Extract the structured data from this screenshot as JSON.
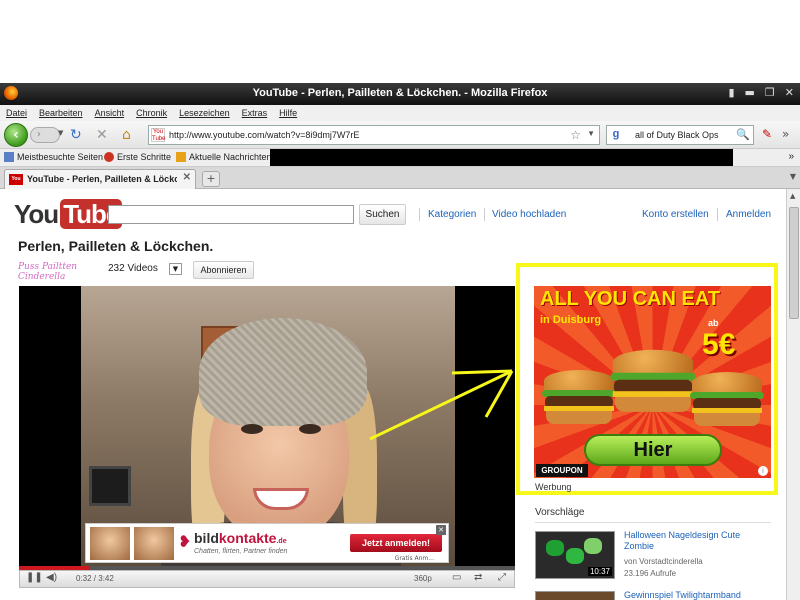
{
  "window": {
    "title": "YouTube - Perlen, Pailleten & Löckchen. - Mozilla Firefox"
  },
  "menu": [
    "Datei",
    "Bearbeiten",
    "Ansicht",
    "Chronik",
    "Lesezeichen",
    "Extras",
    "Hilfe"
  ],
  "navbar": {
    "url": "http://www.youtube.com/watch?v=8i9dmj7W7rE",
    "search_value": "all of Duty Black Ops"
  },
  "bookmarks": [
    "Meistbesuchte Seiten",
    "Erste Schritte",
    "Aktuelle Nachrichten"
  ],
  "tabs": [
    {
      "label": "YouTube - Perlen, Pailleten & Löckch..."
    }
  ],
  "youtube": {
    "logo_you": "You",
    "logo_tube": "Tube",
    "search_button": "Suchen",
    "links": [
      "Kategorien",
      "Video hochladen"
    ],
    "account_links": [
      "Konto erstellen",
      "Anmelden"
    ]
  },
  "video": {
    "title": "Perlen, Pailleten & Löckchen.",
    "channel": "Puss Pailtten Cinderella",
    "video_count": "232 Videos",
    "subscribe": "Abonnieren",
    "time_current": "0:32",
    "time_total": "3:42",
    "time_display": "0:32 / 3:42",
    "quality": "360p",
    "progress": 0.144
  },
  "overlay_ad": {
    "brand_a": "bild",
    "brand_b": "kontakte",
    "brand_suffix": ".de",
    "tagline": "Chatten, flirten, Partner finden",
    "cta": "Jetzt anmelden!",
    "small": "Gratis Anm..."
  },
  "ad": {
    "headline": "ALL YOU CAN EAT",
    "location": "in Duisburg",
    "price_prefix": "ab",
    "price": "5€",
    "cta": "Hier",
    "brand": "GROUPON",
    "label": "Werbung",
    "highlight_color": "#f7f71a"
  },
  "suggestions": {
    "heading": "Vorschläge",
    "items": [
      {
        "title": "Halloween Nageldesign Cute Zombie",
        "author": "von Vorstadtcinderella",
        "views": "23.196 Aufrufe",
        "duration": "10:37"
      },
      {
        "title": "Gewinnspiel Twilightarmband"
      }
    ]
  }
}
